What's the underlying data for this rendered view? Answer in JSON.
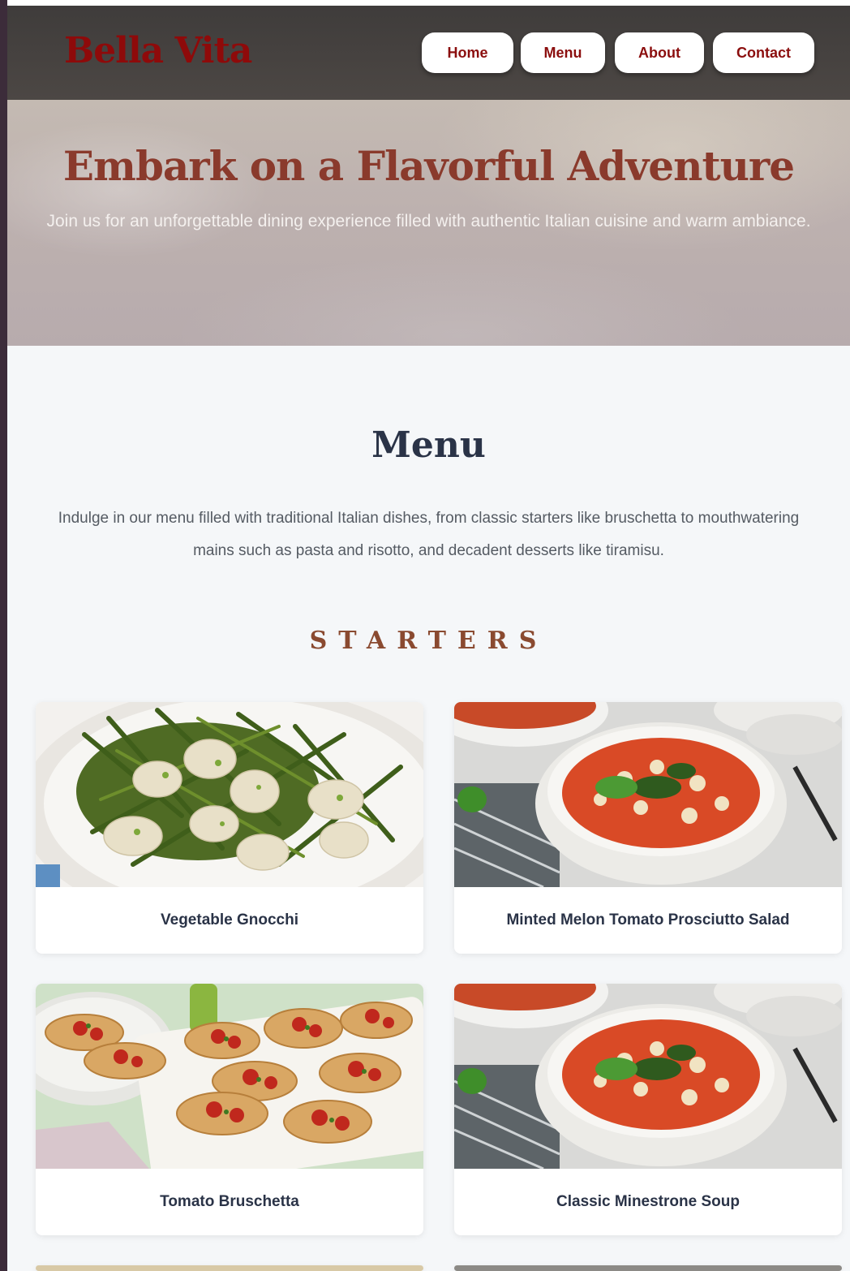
{
  "header": {
    "logo": "Bella Vita",
    "nav": [
      {
        "label": "Home"
      },
      {
        "label": "Menu"
      },
      {
        "label": "About"
      },
      {
        "label": "Contact"
      }
    ]
  },
  "hero": {
    "title": "Embark on a Flavorful Adventure",
    "subtitle": "Join us for an unforgettable dining experience filled with authentic Italian cuisine and warm ambiance."
  },
  "menu": {
    "title": "Menu",
    "intro": "Indulge in our menu filled with traditional Italian dishes, from classic starters like bruschetta to mouthwatering mains such as pasta and risotto, and decadent desserts like tiramisu.",
    "sections": [
      {
        "heading": "STARTERS",
        "items": [
          {
            "name": "Vegetable Gnocchi",
            "image": "gnocchi-photo"
          },
          {
            "name": "Minted Melon Tomato Prosciutto Salad",
            "image": "soup-bowl-photo"
          },
          {
            "name": "Tomato Bruschetta",
            "image": "bruschetta-photo"
          },
          {
            "name": "Classic Minestrone Soup",
            "image": "soup-bowl-photo"
          }
        ]
      }
    ]
  }
}
